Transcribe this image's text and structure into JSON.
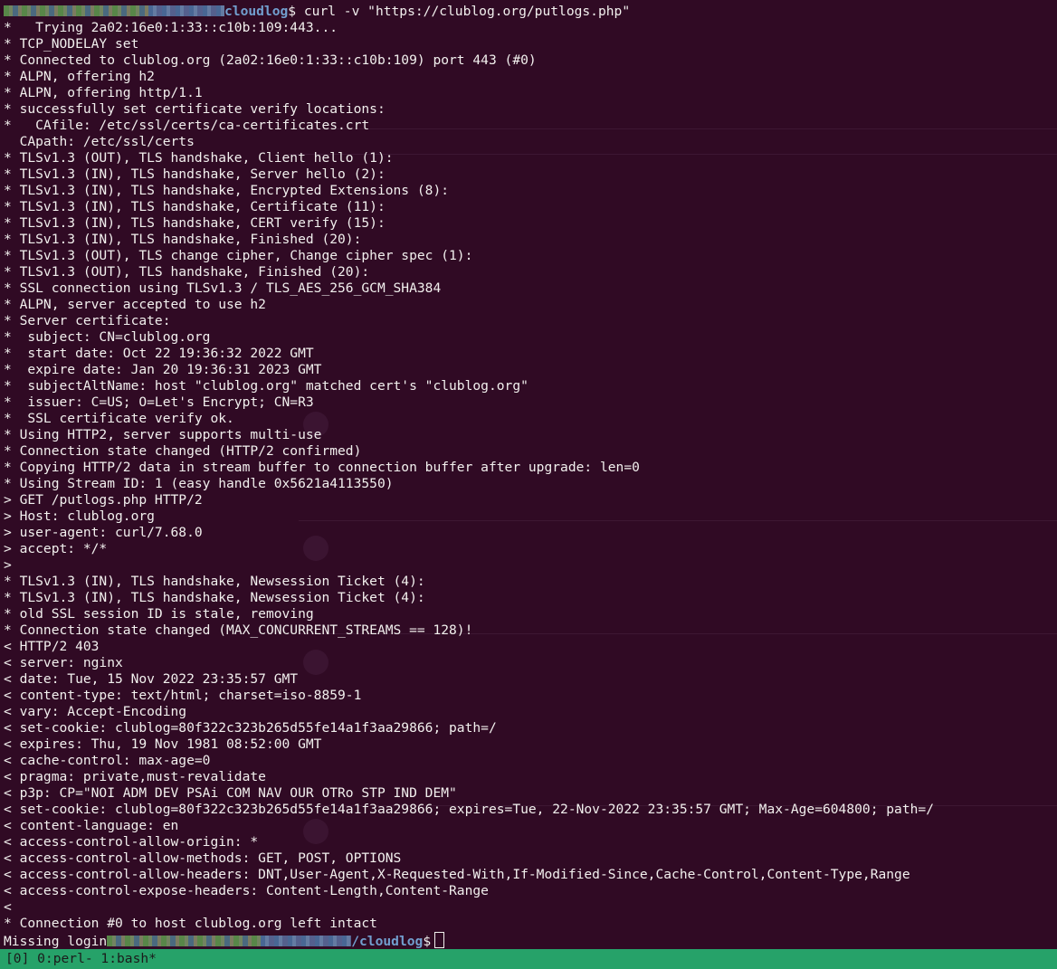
{
  "terminal": {
    "prompt_dir": "cloudlog",
    "command": "$ curl -v \"https://clublog.org/putlogs.php\"",
    "output_lines": [
      "*   Trying 2a02:16e0:1:33::c10b:109:443...",
      "* TCP_NODELAY set",
      "* Connected to clublog.org (2a02:16e0:1:33::c10b:109) port 443 (#0)",
      "* ALPN, offering h2",
      "* ALPN, offering http/1.1",
      "* successfully set certificate verify locations:",
      "*   CAfile: /etc/ssl/certs/ca-certificates.crt",
      "  CApath: /etc/ssl/certs",
      "* TLSv1.3 (OUT), TLS handshake, Client hello (1):",
      "* TLSv1.3 (IN), TLS handshake, Server hello (2):",
      "* TLSv1.3 (IN), TLS handshake, Encrypted Extensions (8):",
      "* TLSv1.3 (IN), TLS handshake, Certificate (11):",
      "* TLSv1.3 (IN), TLS handshake, CERT verify (15):",
      "* TLSv1.3 (IN), TLS handshake, Finished (20):",
      "* TLSv1.3 (OUT), TLS change cipher, Change cipher spec (1):",
      "* TLSv1.3 (OUT), TLS handshake, Finished (20):",
      "* SSL connection using TLSv1.3 / TLS_AES_256_GCM_SHA384",
      "* ALPN, server accepted to use h2",
      "* Server certificate:",
      "*  subject: CN=clublog.org",
      "*  start date: Oct 22 19:36:32 2022 GMT",
      "*  expire date: Jan 20 19:36:31 2023 GMT",
      "*  subjectAltName: host \"clublog.org\" matched cert's \"clublog.org\"",
      "*  issuer: C=US; O=Let's Encrypt; CN=R3",
      "*  SSL certificate verify ok.",
      "* Using HTTP2, server supports multi-use",
      "* Connection state changed (HTTP/2 confirmed)",
      "* Copying HTTP/2 data in stream buffer to connection buffer after upgrade: len=0",
      "* Using Stream ID: 1 (easy handle 0x5621a4113550)",
      "> GET /putlogs.php HTTP/2",
      "> Host: clublog.org",
      "> user-agent: curl/7.68.0",
      "> accept: */*",
      ">",
      "* TLSv1.3 (IN), TLS handshake, Newsession Ticket (4):",
      "* TLSv1.3 (IN), TLS handshake, Newsession Ticket (4):",
      "* old SSL session ID is stale, removing",
      "* Connection state changed (MAX_CONCURRENT_STREAMS == 128)!",
      "< HTTP/2 403",
      "< server: nginx",
      "< date: Tue, 15 Nov 2022 23:35:57 GMT",
      "< content-type: text/html; charset=iso-8859-1",
      "< vary: Accept-Encoding",
      "< set-cookie: clublog=80f322c323b265d55fe14a1f3aa29866; path=/",
      "< expires: Thu, 19 Nov 1981 08:52:00 GMT",
      "< cache-control: max-age=0",
      "< pragma: private,must-revalidate",
      "< p3p: CP=\"NOI ADM DEV PSAi COM NAV OUR OTRo STP IND DEM\"",
      "< set-cookie: clublog=80f322c323b265d55fe14a1f3aa29866; expires=Tue, 22-Nov-2022 23:35:57 GMT; Max-Age=604800; path=/",
      "< content-language: en",
      "< access-control-allow-origin: *",
      "< access-control-allow-methods: GET, POST, OPTIONS",
      "< access-control-allow-headers: DNT,User-Agent,X-Requested-With,If-Modified-Since,Cache-Control,Content-Type,Range",
      "< access-control-expose-headers: Content-Length,Content-Range",
      "<",
      "* Connection #0 to host clublog.org left intact"
    ],
    "last_line_prefix": "Missing login",
    "last_prompt_dir": "/cloudlog",
    "last_prompt_suffix": "$"
  },
  "tmux": {
    "status": "[0] 0:perl- 1:bash*"
  },
  "colors": {
    "background": "#300a24",
    "foreground": "#f2f0ee",
    "prompt_path": "#729fcf",
    "status_bar": "#26a269"
  }
}
